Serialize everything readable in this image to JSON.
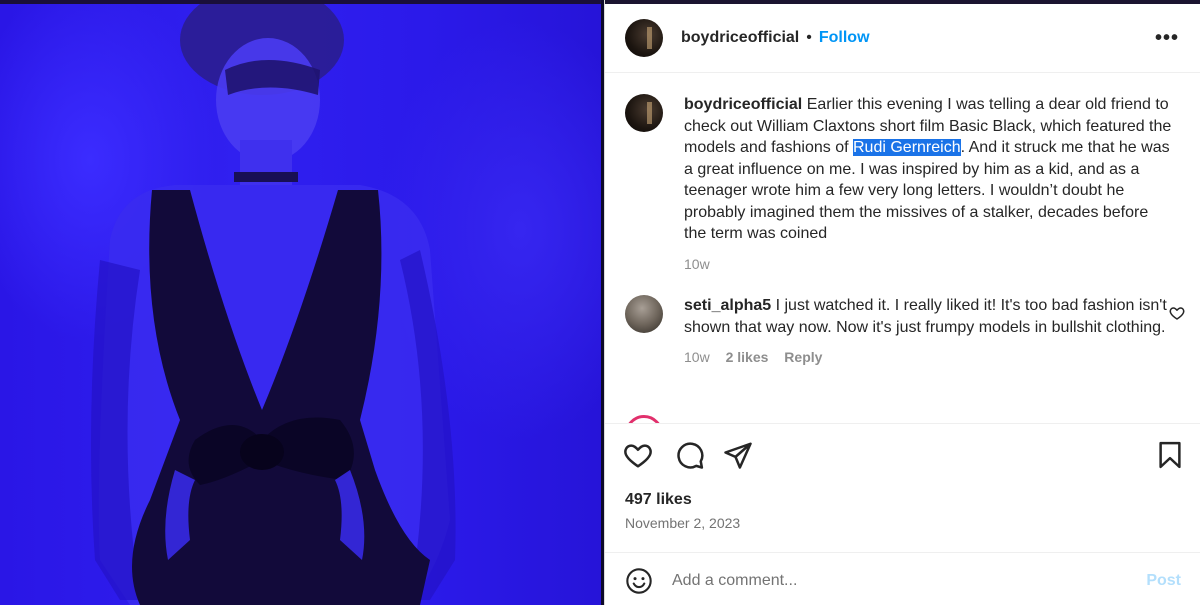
{
  "header": {
    "username": "boydriceofficial",
    "separator": "•",
    "follow_label": "Follow",
    "more_label": "•••"
  },
  "caption": {
    "username": "boydriceofficial",
    "text_before": "Earlier this evening I was telling a dear old friend to check out William Claxtons short film Basic Black, which featured the models and fashions of ",
    "highlighted": "Rudi Gernreich",
    "text_after": ". And it struck me that he was a great influence on me. I was inspired by him as a kid, and as a teenager wrote him a few very long letters. I wouldn’t doubt he probably imagined them the missives of a stalker, decades before the term was coined",
    "age": "10w"
  },
  "comment": {
    "username": "seti_alpha5",
    "text": "I just watched it. I really liked it! It's too bad fashion isn't shown that way now. Now it's just frumpy models in bullshit clothing.",
    "age": "10w",
    "likes": "2 likes",
    "reply_label": "Reply"
  },
  "actions": {
    "icons": [
      "heart-icon",
      "comment-icon",
      "share-icon",
      "bookmark-icon"
    ]
  },
  "post": {
    "likes": "497 likes",
    "date": "November 2, 2023"
  },
  "add_comment": {
    "placeholder": "Add a comment...",
    "post_label": "Post"
  },
  "colors": {
    "accent": "#0095f6",
    "highlight": "#1a73e8",
    "photo_tint": "#2a16e6",
    "post_disabled": "#b3dffc"
  }
}
